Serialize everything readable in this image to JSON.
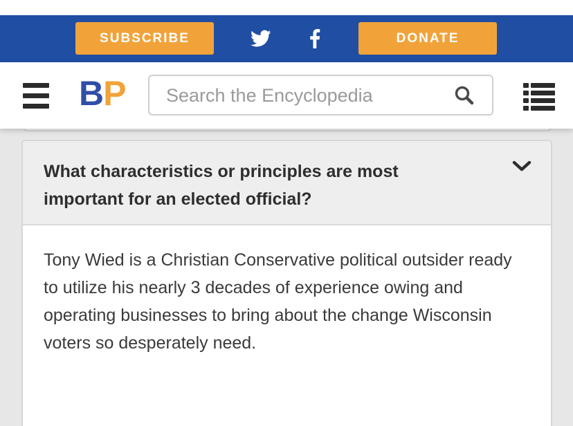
{
  "topbar": {
    "subscribe_label": "SUBSCRIBE",
    "donate_label": "DONATE",
    "social": [
      "twitter-icon",
      "facebook-icon"
    ]
  },
  "header": {
    "logo_b": "B",
    "logo_p": "P",
    "search_placeholder": "Search the Encyclopedia",
    "icons": [
      "hamburger-menu-icon",
      "search-icon",
      "list-icon"
    ]
  },
  "accordion": {
    "question": "What characteristics or principles are most important for an elected official?",
    "answer": "Tony Wied is a Christian Conservative political outsider ready to utilize his nearly 3 decades of experience owing and operating businesses to bring about the change Wisconsin voters so desperately need.",
    "expanded": true
  },
  "colors": {
    "brand_blue": "#1f4ea3",
    "accent_orange": "#f1a33a",
    "logo_blue": "#2f4ea8"
  }
}
